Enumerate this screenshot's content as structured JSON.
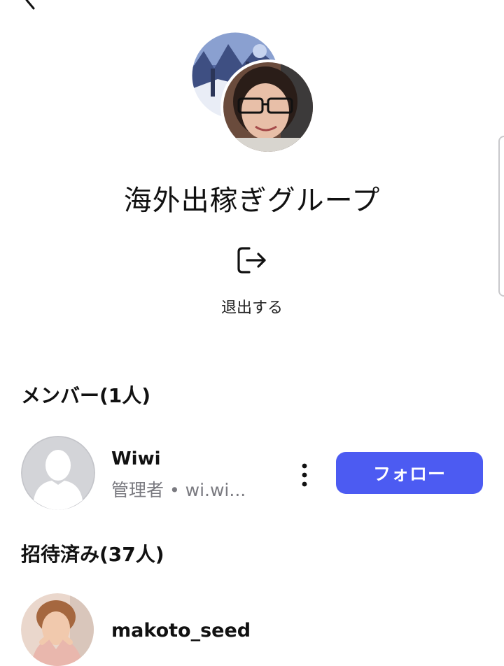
{
  "header": {
    "back_icon": "chevron-left-icon"
  },
  "group": {
    "name": "海外出稼ぎグループ",
    "leave_label": "退出する",
    "leave_icon": "logout-icon"
  },
  "members": {
    "heading": "メンバー(1人)",
    "items": [
      {
        "name": "Wiwi",
        "subtitle": "管理者 • wi.wi...",
        "follow_label": "フォロー",
        "more_icon": "more-vertical-icon"
      }
    ]
  },
  "invited": {
    "heading": "招待済み(37人)",
    "items": [
      {
        "name": "makoto_seed"
      }
    ]
  },
  "colors": {
    "accent": "#4c5bf2",
    "secondary_text": "#7a7a80",
    "placeholder_avatar": "#d3d4d8"
  }
}
